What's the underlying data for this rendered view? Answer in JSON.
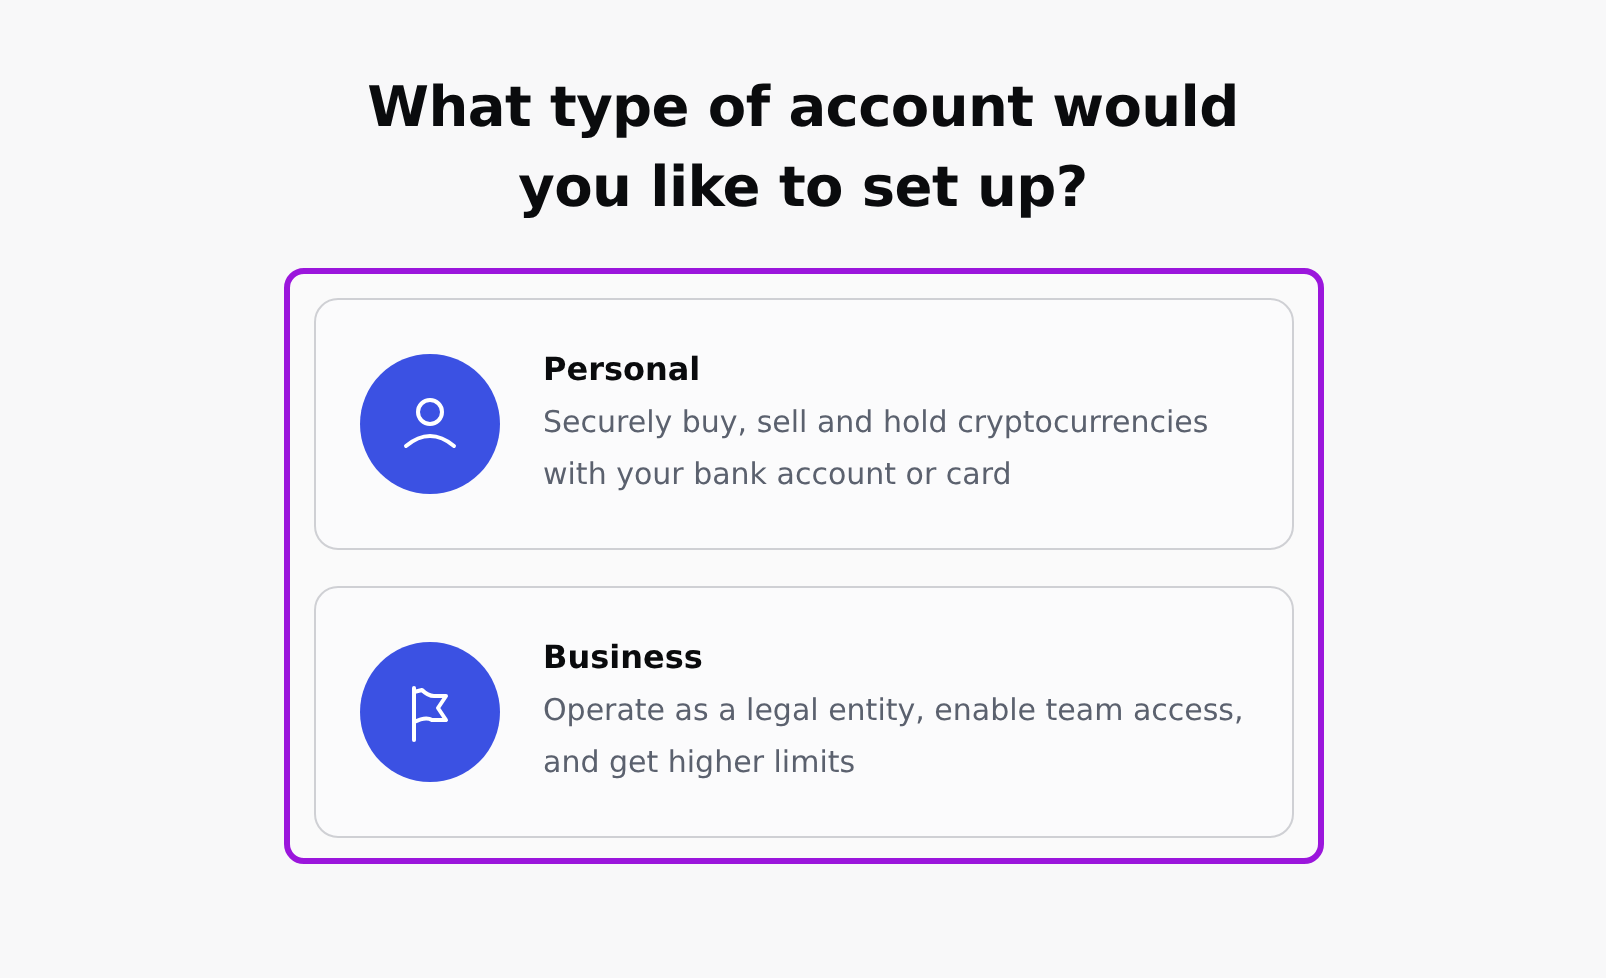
{
  "heading": "What type of account would you like to set up?",
  "options": [
    {
      "kind": "person",
      "title": "Personal",
      "description": "Securely buy, sell and hold cryptocurrencies with your bank account or card"
    },
    {
      "kind": "flag",
      "title": "Business",
      "description": "Operate as a legal entity, enable team access, and get higher limits"
    }
  ]
}
